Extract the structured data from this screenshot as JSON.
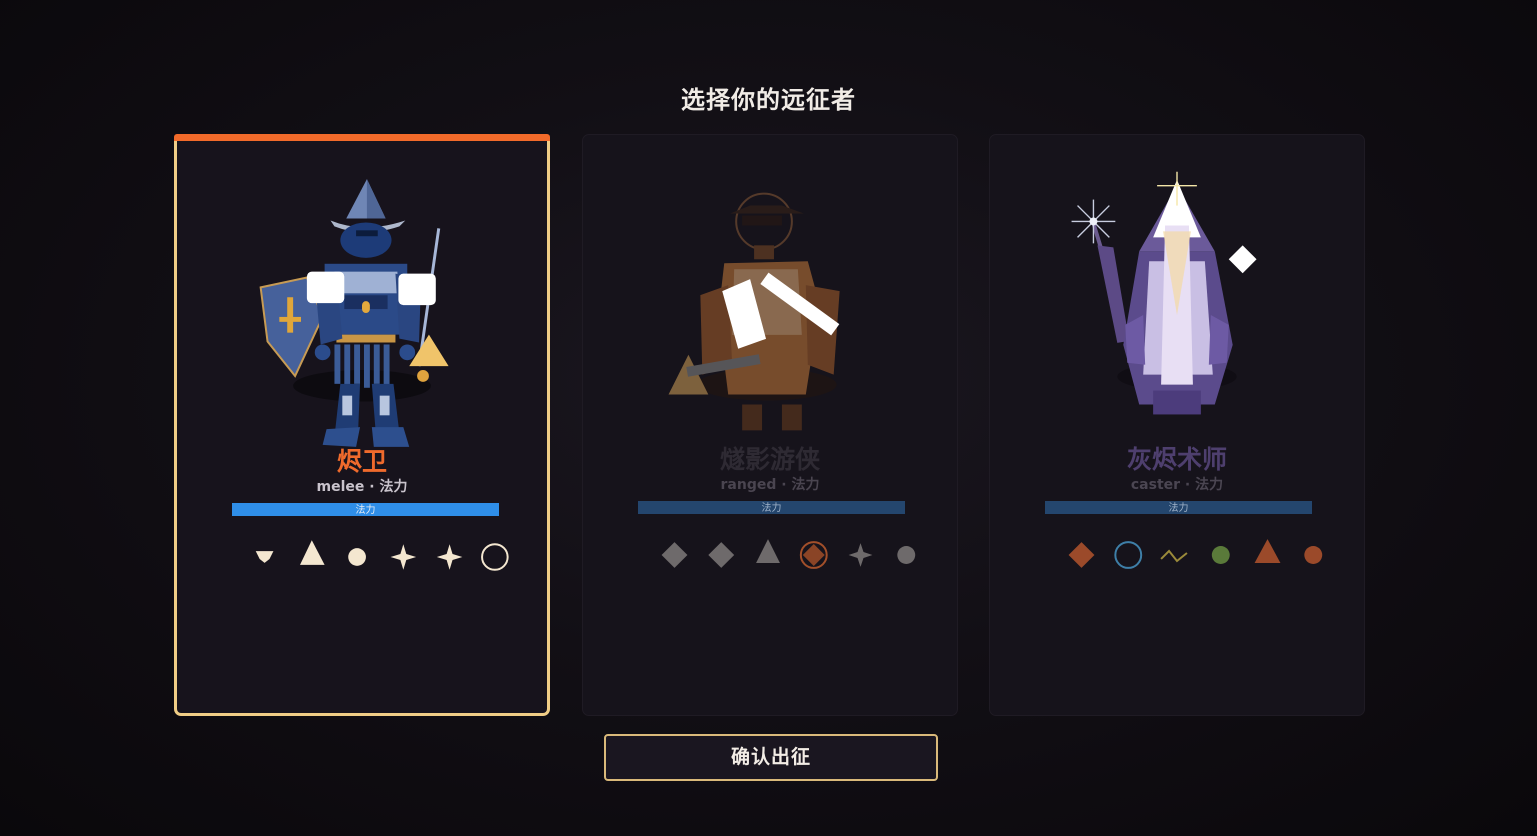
{
  "screen": {
    "title": "选择你的远征者",
    "confirm_label": "确认出征"
  },
  "heroes": [
    {
      "name": "烬卫",
      "sub": "melee · 法力",
      "bar_label": "法力",
      "selected": true,
      "name_color": "#ef6a2c",
      "sub_color": "#c9c3cc",
      "bar_color": "#2f8ee8",
      "runes": [
        "gem-icon",
        "triangle-icon",
        "dot-icon",
        "spark-icon",
        "spark-icon",
        "ring-icon"
      ]
    },
    {
      "name": "燧影游侠",
      "sub": "ranged · 法力",
      "bar_label": "法力",
      "selected": false,
      "name_color": "#2e2a33",
      "sub_color": "#4a4550",
      "bar_color": "#24466e",
      "runes": [
        "diamond-icon",
        "diamond-icon",
        "triangle-icon",
        "diamond-ring-icon",
        "spark-icon",
        "dot-icon"
      ]
    },
    {
      "name": "灰烬术师",
      "sub": "caster · 法力",
      "bar_label": "法力",
      "selected": false,
      "name_color": "#4e3f6e",
      "sub_color": "#4b4652",
      "bar_color": "#24466e",
      "runes": [
        "diamond-icon",
        "ring-icon",
        "zigzag-icon",
        "dot-icon",
        "triangle-icon",
        "dot-icon"
      ]
    }
  ]
}
